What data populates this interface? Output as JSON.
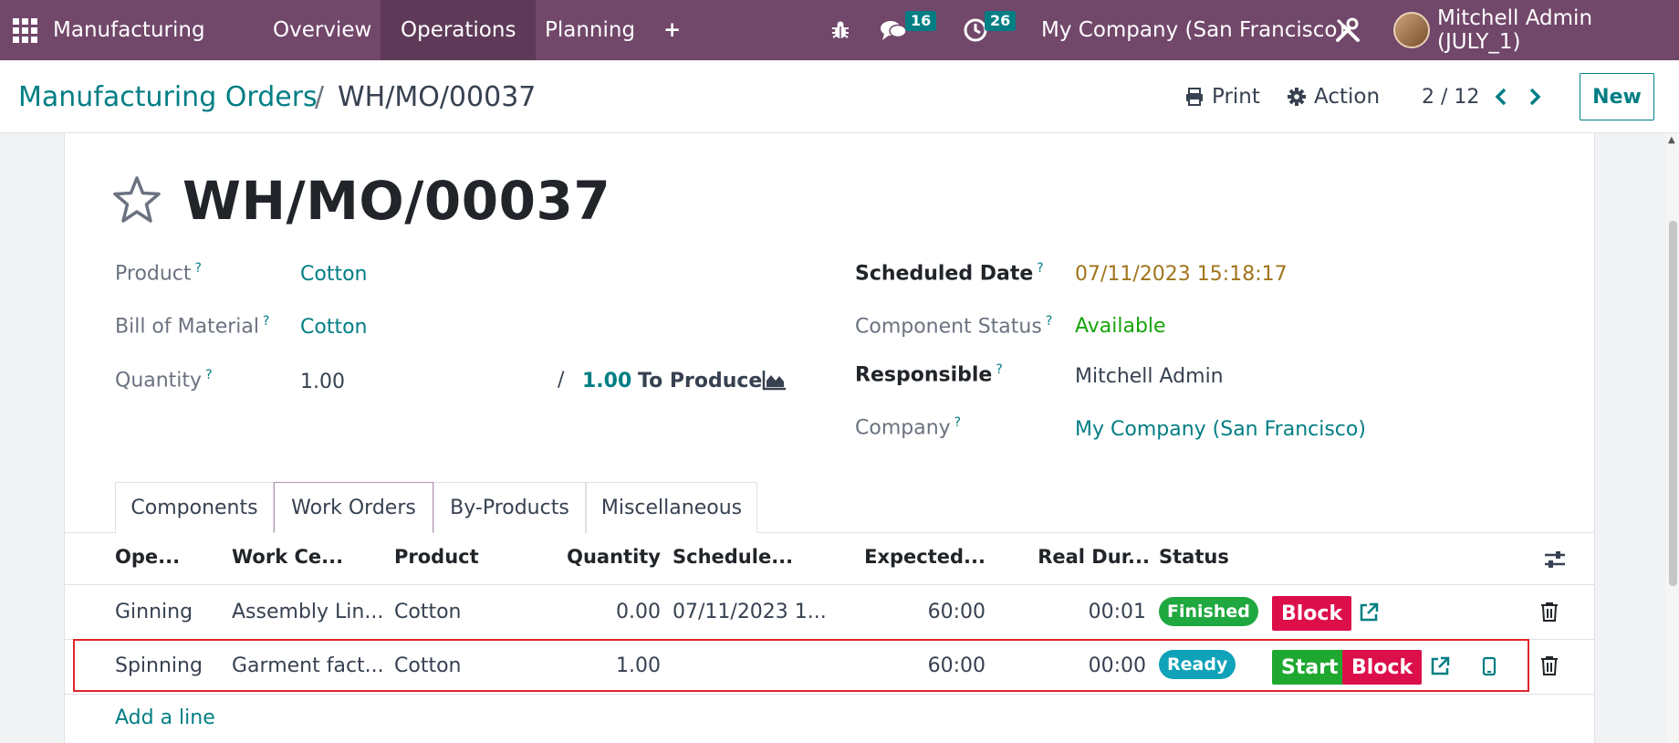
{
  "navbar": {
    "app_name": "Manufacturing",
    "menu": [
      "Overview",
      "Operations",
      "Planning"
    ],
    "active_menu": "Operations",
    "messages_count": "16",
    "activities_count": "26",
    "company": "My Company (San Francisco)",
    "user": "Mitchell Admin (JULY_1)"
  },
  "breadcrumb": {
    "parent": "Manufacturing Orders",
    "separator": "/",
    "current": "WH/MO/00037"
  },
  "toolbar": {
    "print_label": "Print",
    "action_label": "Action",
    "pager": "2 / 12",
    "new_label": "New"
  },
  "record": {
    "title": "WH/MO/00037",
    "product_label": "Product",
    "product": "Cotton",
    "bom_label": "Bill of Material",
    "bom": "Cotton",
    "quantity_label": "Quantity",
    "quantity": "1.00",
    "qty_separator": "/",
    "to_produce_qty": "1.00",
    "to_produce_label": "To Produce",
    "scheduled_date_label": "Scheduled Date",
    "scheduled_date": "07/11/2023 15:18:17",
    "component_status_label": "Component Status",
    "component_status": "Available",
    "responsible_label": "Responsible",
    "responsible": "Mitchell Admin",
    "company_label": "Company",
    "company": "My Company (San Francisco)",
    "help_mark": "?"
  },
  "tabs": [
    "Components",
    "Work Orders",
    "By-Products",
    "Miscellaneous"
  ],
  "active_tab": "Work Orders",
  "work_orders": {
    "columns": [
      "Ope...",
      "Work Ce...",
      "Product",
      "Quantity",
      "Schedule...",
      "Expected...",
      "Real Dur...",
      "Status"
    ],
    "rows": [
      {
        "operation": "Ginning",
        "work_center": "Assembly Lin...",
        "product": "Cotton",
        "quantity": "0.00",
        "scheduled": "07/11/2023 1...",
        "expected": "60:00",
        "real_duration": "00:01",
        "status": "Finished",
        "block_label": "Block"
      },
      {
        "operation": "Spinning",
        "work_center": "Garment fact...",
        "product": "Cotton",
        "quantity": "1.00",
        "scheduled": "",
        "expected": "60:00",
        "real_duration": "00:00",
        "status": "Ready",
        "start_label": "Start",
        "block_label": "Block"
      }
    ],
    "add_line_label": "Add a line"
  },
  "colors": {
    "navbar": "#71476a",
    "accent": "#017e84",
    "finished": "#20a840",
    "ready": "#10a2b8",
    "block": "#dc0f4b",
    "start": "#1fa830",
    "highlight": "#e0262b"
  }
}
